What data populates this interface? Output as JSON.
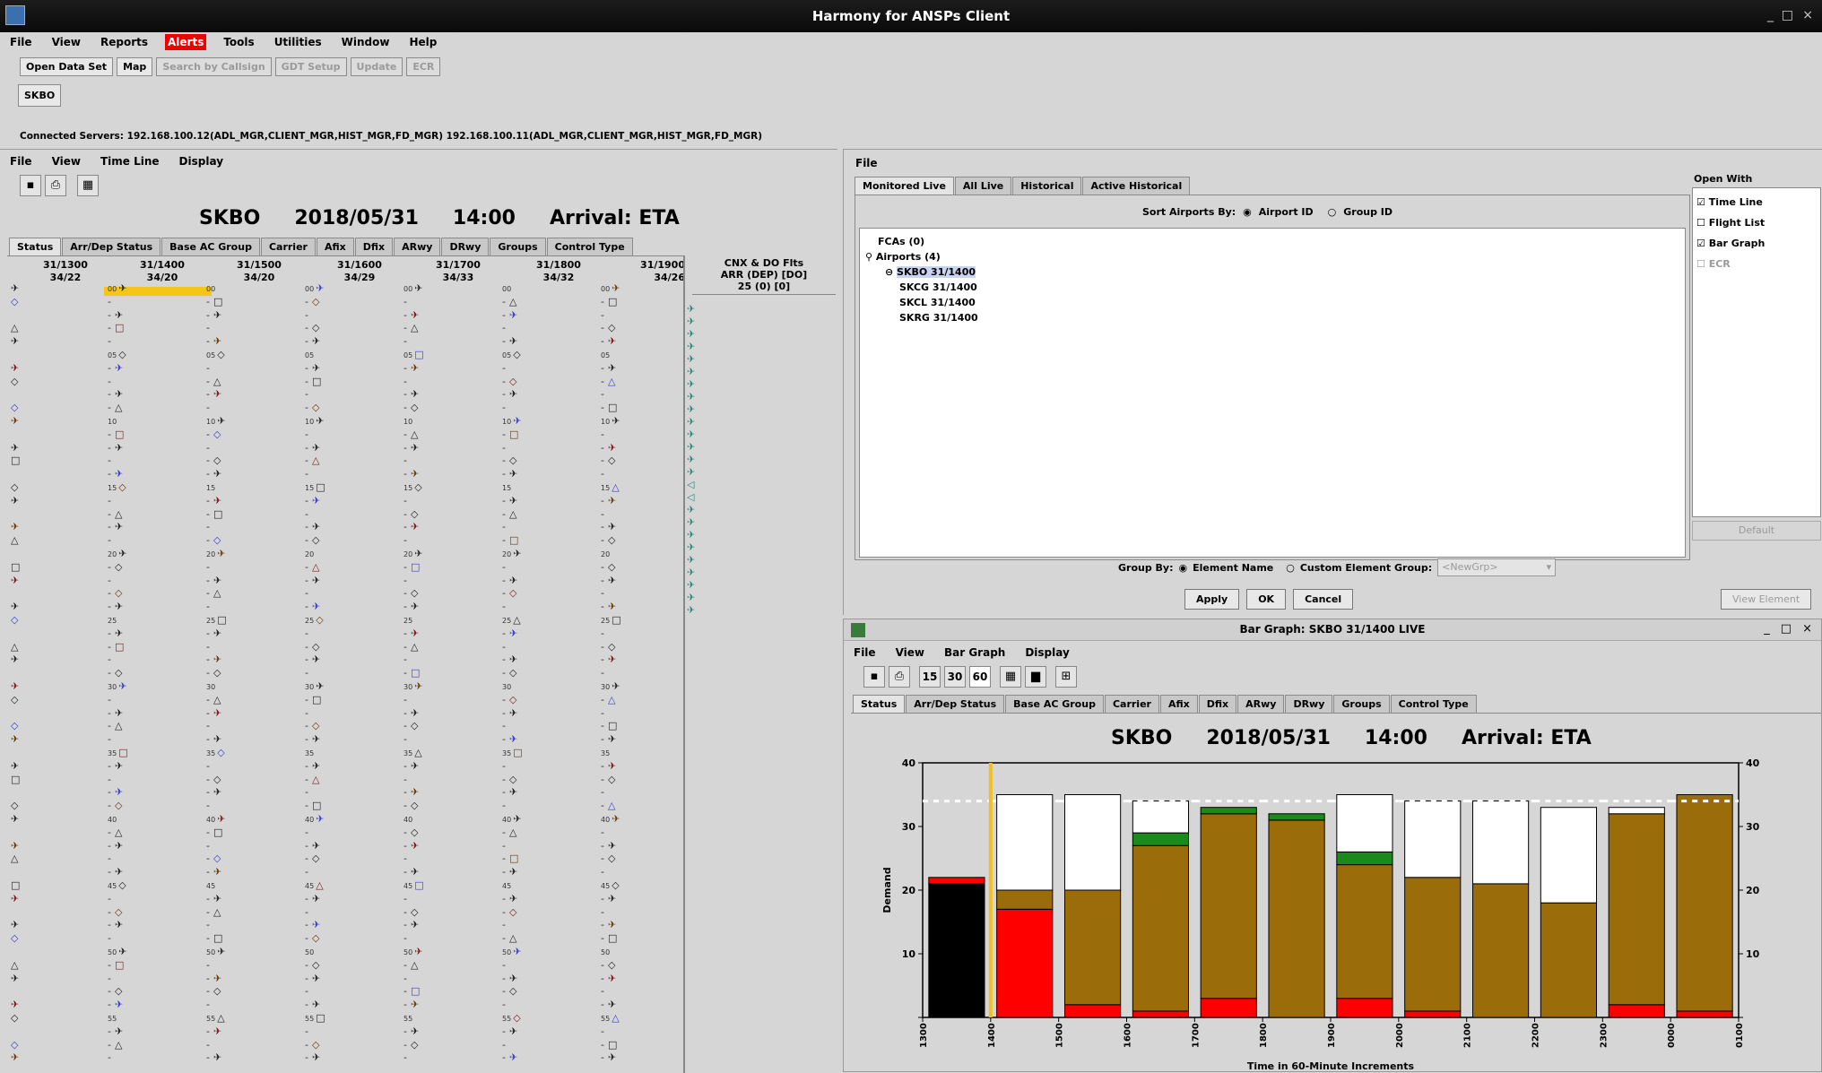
{
  "window": {
    "title": "Harmony for ANSPs Client",
    "minimize": "_",
    "maximize": "□",
    "close": "×"
  },
  "main_menu": [
    "File",
    "View",
    "Reports",
    "Alerts",
    "Tools",
    "Utilities",
    "Window",
    "Help"
  ],
  "toolbar": {
    "open_data_set": "Open Data Set",
    "map": "Map",
    "search_by_callsign": "Search by Callsign",
    "gdt_setup": "GDT Setup",
    "update": "Update",
    "ecr": "ECR"
  },
  "airport_tab": "SKBO",
  "connected_servers": "Connected Servers: 192.168.100.12(ADL_MGR,CLIENT_MGR,HIST_MGR,FD_MGR) 192.168.100.11(ADL_MGR,CLIENT_MGR,HIST_MGR,FD_MGR)",
  "timeline": {
    "menu": [
      "File",
      "View",
      "Time Line",
      "Display"
    ],
    "header": {
      "airport": "SKBO",
      "date": "2018/05/31",
      "time": "14:00",
      "mode": "Arrival: ETA"
    },
    "tabs": [
      "Status",
      "Arr/Dep Status",
      "Base AC Group",
      "Carrier",
      "Afix",
      "Dfix",
      "ARwy",
      "DRwy",
      "Groups",
      "Control Type"
    ],
    "columns": [
      {
        "top": "31/1300",
        "bottom": "34/22"
      },
      {
        "top": "31/1400",
        "bottom": "34/20"
      },
      {
        "top": "31/1500",
        "bottom": "34/20"
      },
      {
        "top": "31/1600",
        "bottom": "34/29"
      },
      {
        "top": "31/1700",
        "bottom": "34/33"
      },
      {
        "top": "31/1800",
        "bottom": "34/32"
      },
      {
        "top": "31/1900",
        "bottom": "34/26"
      }
    ],
    "cnx_header": {
      "line1": "CNX & DO Flts",
      "line2": "ARR (DEP) [DO]",
      "line3": "25 (0) [0]"
    },
    "minute_labels": [
      "00",
      "05",
      "10",
      "15",
      "20",
      "25",
      "30",
      "35",
      "40",
      "45",
      "50",
      "55"
    ]
  },
  "monitor": {
    "menu": [
      "File"
    ],
    "tabs": [
      "Monitored Live",
      "All Live",
      "Historical",
      "Active Historical"
    ],
    "sort_label": "Sort Airports By:",
    "sort_opt1": "Airport ID",
    "sort_opt2": "Group ID",
    "tree": {
      "fcas": "FCAs (0)",
      "airports": "Airports (4)",
      "items": [
        "SKBO 31/1400",
        "SKCG 31/1400",
        "SKCL 31/1400",
        "SKRG 31/1400"
      ]
    },
    "open_with": {
      "title": "Open With",
      "items": [
        {
          "label": "Time Line",
          "checked": true
        },
        {
          "label": "Flight List",
          "checked": false
        },
        {
          "label": "Bar Graph",
          "checked": true
        },
        {
          "label": "ECR",
          "checked": false
        }
      ],
      "default": "Default"
    },
    "group_by": {
      "label": "Group By:",
      "opt1": "Element Name",
      "opt2": "Custom Element Group:",
      "select_placeholder": "<NewGrp>"
    },
    "buttons": {
      "apply": "Apply",
      "ok": "OK",
      "cancel": "Cancel",
      "view_element": "View Element"
    }
  },
  "bargraph": {
    "title": "Bar Graph: SKBO 31/1400 LIVE",
    "menu": [
      "File",
      "View",
      "Bar Graph",
      "Display"
    ],
    "intervals": [
      "15",
      "30",
      "60"
    ],
    "tabs": [
      "Status",
      "Arr/Dep Status",
      "Base AC Group",
      "Carrier",
      "Afix",
      "Dfix",
      "ARwy",
      "DRwy",
      "Groups",
      "Control Type"
    ],
    "header": {
      "airport": "SKBO",
      "date": "2018/05/31",
      "time": "14:00",
      "mode": "Arrival: ETA"
    }
  },
  "chart_data": {
    "type": "bar",
    "categories": [
      "1300",
      "1400",
      "1500",
      "1600",
      "1700",
      "1800",
      "1900",
      "2000",
      "2100",
      "2200",
      "2300",
      "0000",
      "0100"
    ],
    "ylabel": "Demand",
    "xlabel": "Time in 60-Minute Increments",
    "ylim": [
      0,
      40
    ],
    "yticks": [
      0,
      10,
      20,
      30,
      40
    ],
    "capacity": 34,
    "current_time": "1400",
    "colors": {
      "black": "#000000",
      "red": "#ff0000",
      "brown": "#9a6c0a",
      "green": "#1a8a1a",
      "white": "#ffffff",
      "current_line": "#f0c020"
    },
    "bars": [
      {
        "black": 21,
        "red": 1,
        "brown": 0,
        "green": 0,
        "white": 0
      },
      {
        "black": 0,
        "red": 17,
        "brown": 3,
        "green": 0,
        "white": 15
      },
      {
        "black": 0,
        "red": 2,
        "brown": 18,
        "green": 0,
        "white": 15
      },
      {
        "black": 0,
        "red": 1,
        "brown": 26,
        "green": 2,
        "white": 5
      },
      {
        "black": 0,
        "red": 3,
        "brown": 29,
        "green": 1,
        "white": 0
      },
      {
        "black": 0,
        "red": 0,
        "brown": 31,
        "green": 1,
        "white": 0
      },
      {
        "black": 0,
        "red": 3,
        "brown": 21,
        "green": 2,
        "white": 9
      },
      {
        "black": 0,
        "red": 1,
        "brown": 21,
        "green": 0,
        "white": 12
      },
      {
        "black": 0,
        "red": 0,
        "brown": 21,
        "green": 0,
        "white": 13
      },
      {
        "black": 0,
        "red": 0,
        "brown": 18,
        "green": 0,
        "white": 15
      },
      {
        "black": 0,
        "red": 2,
        "brown": 30,
        "green": 0,
        "white": 1
      },
      {
        "black": 0,
        "red": 1,
        "brown": 34,
        "green": 0,
        "white": 0
      }
    ]
  }
}
